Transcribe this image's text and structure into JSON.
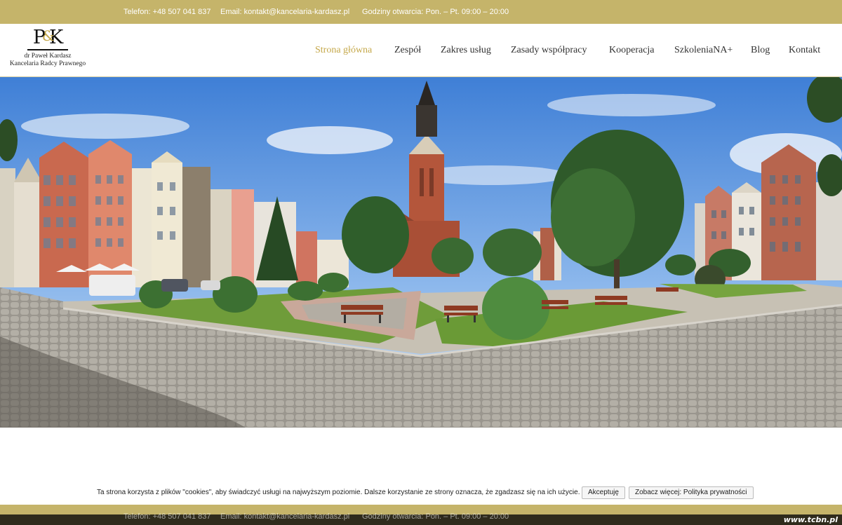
{
  "topbar": {
    "phone": "Telefon: +48 507 041 837",
    "email": "Email: kontakt@kancelaria-kardasz.pl",
    "hours": "Godziny otwarcia: Pon. – Pt. 09:00 – 20:00"
  },
  "logo": {
    "monogram_left": "P",
    "monogram_amp": "&",
    "monogram_right": "K",
    "line1": "dr Paweł Kardasz",
    "line2": "Kancelaria Radcy Prawnego"
  },
  "nav": {
    "items": [
      {
        "label": "Strona główna",
        "active": true
      },
      {
        "label": "Zespół"
      },
      {
        "label": "Zakres usług"
      },
      {
        "label": "Zasady współpracy"
      },
      {
        "label": "Kooperacja"
      },
      {
        "label": "SzkoleniaNA+"
      },
      {
        "label": "Blog"
      },
      {
        "label": "Kontakt"
      }
    ]
  },
  "cookie": {
    "message": "Ta strona korzysta z plików \"cookies\", aby świadczyć usługi na najwyższym poziomie. Dalsze korzystanie ze strony oznacza, że zgadzasz się na ich użycie.",
    "accept": "Akceptuję",
    "more": "Zobacz więcej: Polityka prywatności"
  },
  "bottombar": {
    "phone": "Telefon: +48 507 041 837",
    "email": "Email: kontakt@kancelaria-kardasz.pl",
    "hours": "Godziny otwarcia: Pon. – Pt. 09:00 – 20:00"
  },
  "watermark": "www.tcbn.pl",
  "colors": {
    "accent": "#c5b46a",
    "nav_active": "#c5a84a",
    "nav_text": "#333333"
  }
}
